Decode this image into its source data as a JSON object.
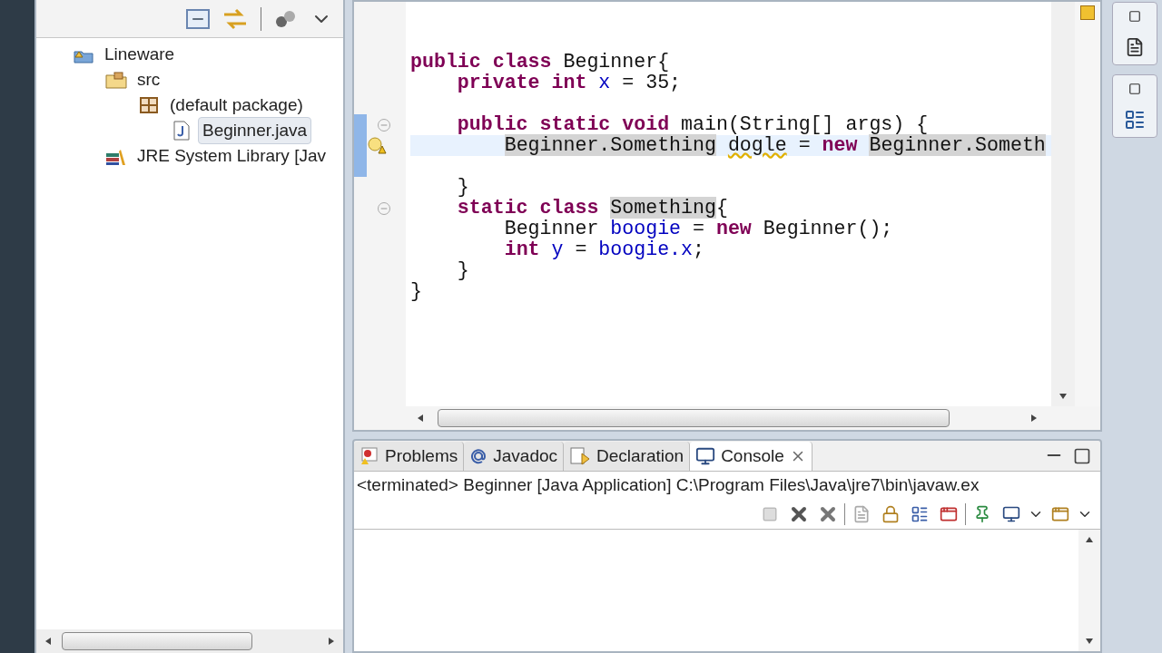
{
  "explorer": {
    "items": [
      {
        "label": "Lineware",
        "kind": "project",
        "selected": false,
        "children": [
          {
            "label": "src",
            "kind": "folder",
            "selected": false,
            "children": [
              {
                "label": "(default package)",
                "kind": "package",
                "selected": false,
                "children": [
                  {
                    "label": "Beginner.java",
                    "kind": "file",
                    "selected": true
                  }
                ]
              }
            ]
          },
          {
            "label": "JRE System Library [Jav",
            "kind": "library",
            "selected": false
          }
        ]
      }
    ]
  },
  "editor": {
    "lines": [
      {
        "current": false,
        "tokens": [
          {
            "kind": "keyword",
            "text": "public"
          },
          {
            "kind": "keyword",
            "text": " class"
          },
          {
            "kind": "plain",
            "text": " Beginner{"
          }
        ],
        "children": [
          {
            "current": false,
            "tokens": [
              {
                "kind": "keyword",
                "text": "private"
              },
              {
                "kind": "keyword",
                "text": " int"
              },
              {
                "kind": "field",
                "text": " x"
              },
              {
                "kind": "plain",
                "text": " = 35;"
              }
            ]
          },
          {
            "current": false
          },
          {
            "current": false,
            "collapsed": false,
            "tokens": [
              {
                "kind": "keyword",
                "text": "public"
              },
              {
                "kind": "keyword",
                "text": " static"
              },
              {
                "kind": "keyword",
                "text": " void"
              },
              {
                "kind": "plain",
                "text": " main(String[] args) {"
              }
            ],
            "children": [
              {
                "current": true,
                "warning": true,
                "tokens": [
                  {
                    "kind": "occurrence",
                    "text": "Beginner.Something"
                  },
                  {
                    "kind": "warning",
                    "text": "dogle",
                    "space_before": true
                  },
                  {
                    "kind": "plain",
                    "text": " = "
                  },
                  {
                    "kind": "keyword",
                    "text": "new"
                  },
                  {
                    "kind": "occurrence",
                    "text": "Beginner.Someth",
                    "space_before": true
                  }
                ]
              },
              {
                "current": false
              }
            ]
          },
          {
            "current": false,
            "tokens": [
              {
                "kind": "plain",
                "text": "}"
              }
            ]
          },
          {
            "current": false,
            "collapsed": false,
            "tokens": [
              {
                "kind": "keyword",
                "text": "static"
              },
              {
                "kind": "keyword",
                "text": " class"
              },
              {
                "kind": "occurrence",
                "text": "Something",
                "space_before": true
              },
              {
                "kind": "plain",
                "text": "{"
              }
            ],
            "children": [
              {
                "current": false,
                "tokens": [
                  {
                    "kind": "plain",
                    "text": "Beginner"
                  },
                  {
                    "kind": "field",
                    "text": " boogie"
                  },
                  {
                    "kind": "plain",
                    "text": " ="
                  },
                  {
                    "kind": "keyword",
                    "text": " new"
                  },
                  {
                    "kind": "plain",
                    "text": " Beginner();"
                  }
                ]
              },
              {
                "current": false,
                "tokens": [
                  {
                    "kind": "keyword",
                    "text": "int"
                  },
                  {
                    "kind": "field",
                    "text": " y"
                  },
                  {
                    "kind": "plain",
                    "text": " ="
                  },
                  {
                    "kind": "field",
                    "text": " boogie.x"
                  },
                  {
                    "kind": "plain",
                    "text": ";"
                  }
                ]
              }
            ]
          },
          {
            "current": false,
            "tokens": [
              {
                "kind": "plain",
                "text": "}"
              }
            ]
          }
        ]
      },
      {
        "current": false,
        "tokens": [
          {
            "kind": "plain",
            "text": "}"
          }
        ]
      }
    ]
  },
  "console": {
    "tabs": [
      {
        "label": "Problems",
        "kind": "problems",
        "selected": false
      },
      {
        "label": "Javadoc",
        "kind": "javadoc",
        "selected": false
      },
      {
        "label": "Declaration",
        "kind": "declaration",
        "selected": false
      },
      {
        "label": "Console",
        "kind": "console",
        "selected": true
      }
    ],
    "status": "<terminated> Beginner [Java Application] C:\\Program Files\\Java\\jre7\\bin\\javaw.ex"
  }
}
